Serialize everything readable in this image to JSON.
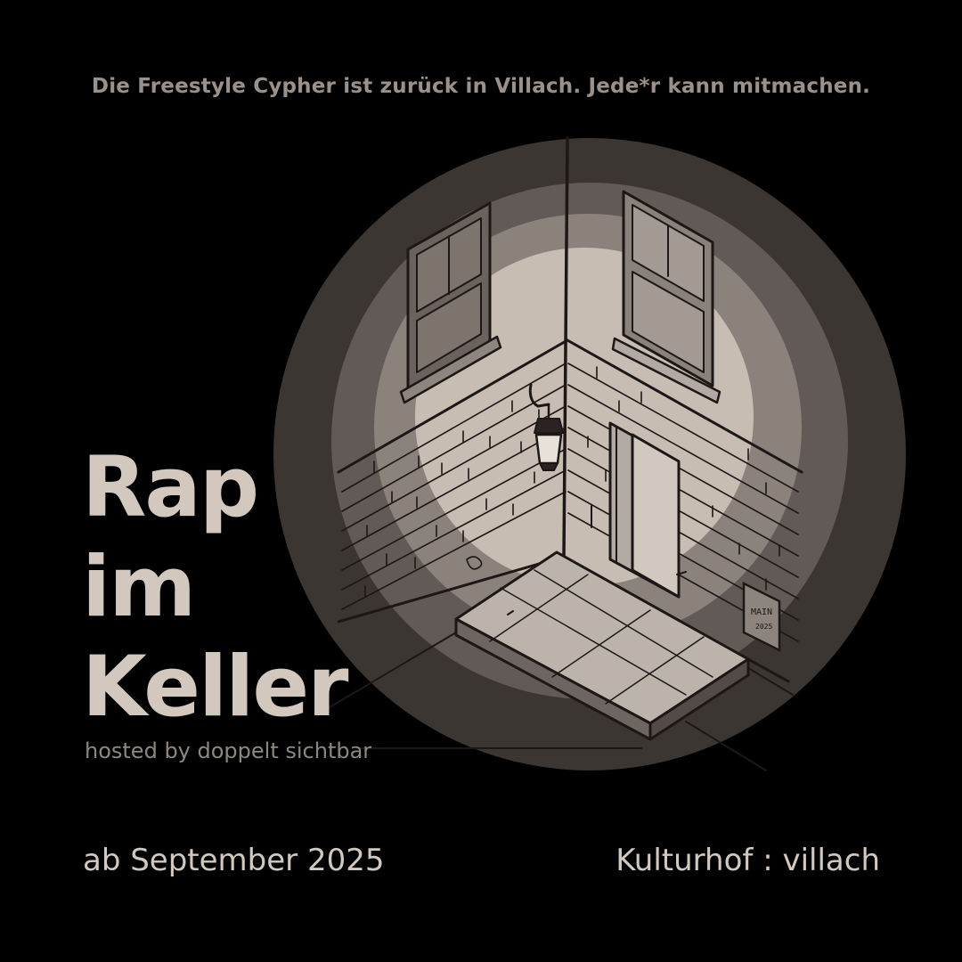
{
  "poster": {
    "tagline": "Die Freestyle Cypher ist zurück in Villach. Jede*r kann mitmachen.",
    "title_lines": [
      "Rap",
      "im",
      "Keller"
    ],
    "hosted_by": "hosted by doppelt sichtbar",
    "date": "ab September 2025",
    "venue": "Kulturhof : villach",
    "sign_text": [
      "MAIN",
      "2025"
    ]
  },
  "colors": {
    "background": "#000000",
    "title": "#d2c8be",
    "tagline": "#9a928a",
    "host": "#8e8780",
    "spotlight_ring_1": "#3c3633",
    "spotlight_ring_2": "#625a56",
    "spotlight_ring_3": "#8b827c",
    "spotlight_core": "#c7bdb3",
    "line_art": "#1d1715"
  }
}
